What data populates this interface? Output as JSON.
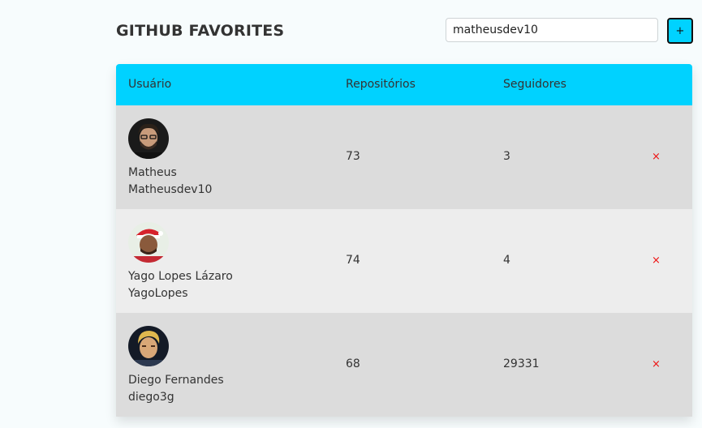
{
  "header": {
    "title": "GITHUB FAVORITES",
    "search_value": "matheusdev10",
    "add_label": "+"
  },
  "table": {
    "columns": [
      "Usuário",
      "Repositórios",
      "Seguidores"
    ],
    "rows": [
      {
        "name": "Matheus",
        "login": "Matheusdev10",
        "repos": "73",
        "followers": "3",
        "remove": "×"
      },
      {
        "name": "Yago Lopes Lázaro",
        "login": "YagoLopes",
        "repos": "74",
        "followers": "4",
        "remove": "×"
      },
      {
        "name": "Diego Fernandes",
        "login": "diego3g",
        "repos": "68",
        "followers": "29331",
        "remove": "×"
      }
    ]
  },
  "colors": {
    "accent": "#00d2ff",
    "row_odd": "#dcdcdc",
    "row_even": "#ededed",
    "remove": "#ee1111"
  }
}
